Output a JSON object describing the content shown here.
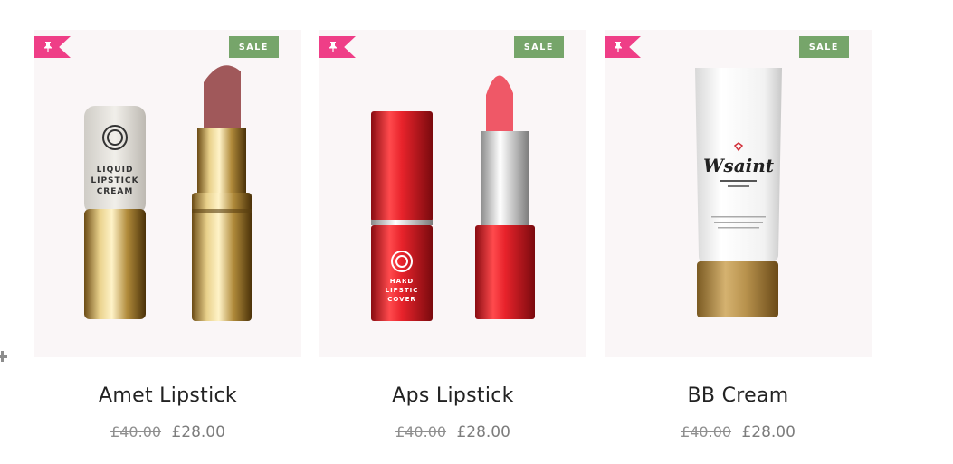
{
  "badges": {
    "sale_label": "SALE"
  },
  "products": [
    {
      "name": "Amet Lipstick",
      "old_price": "£40.00",
      "price": "£28.00",
      "packaging_text": [
        "LIQUID",
        "LIPSTICK",
        "CREAM"
      ]
    },
    {
      "name": "Aps Lipstick",
      "old_price": "£40.00",
      "price": "£28.00",
      "packaging_text": [
        "HARD",
        "LIPSTIC",
        "COVER"
      ]
    },
    {
      "name": "BB Cream",
      "old_price": "£40.00",
      "price": "£28.00",
      "packaging_text": [
        "Wsaint"
      ]
    }
  ],
  "colors": {
    "pin": "#ef3e87",
    "sale_badge": "#76a56a",
    "card_bg": "#faf6f7"
  },
  "icons": {
    "pin": "pushpin-icon",
    "expand": "plus-icon"
  }
}
